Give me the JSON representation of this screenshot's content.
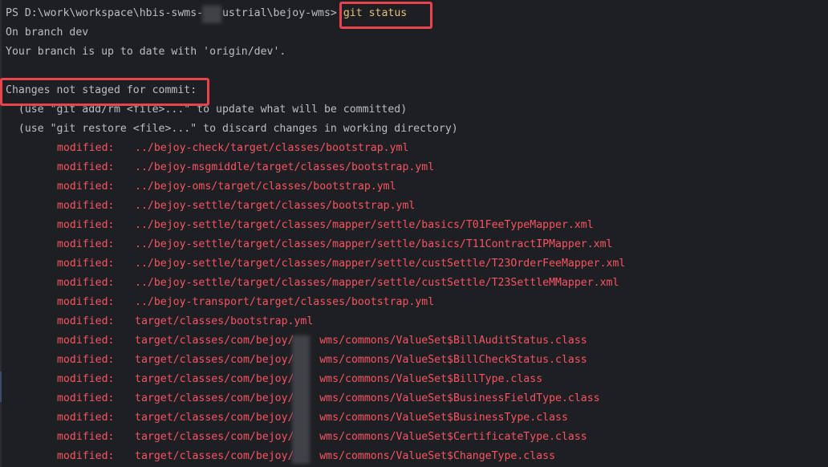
{
  "terminal": {
    "prompt": "PS D:\\work\\workspace\\hbis-swms-   ustrial\\bejoy-wms>",
    "command": "git status",
    "branch_line": "On branch dev",
    "uptodate_line": "Your branch is up to date with 'origin/dev'.",
    "changes_header": "Changes not staged for commit:",
    "hint_add": "  (use \"git add/rm <file>...\" to update what will be committed)",
    "hint_restore": "  (use \"git restore <file>...\" to discard changes in working directory)",
    "modified_label": "modified:",
    "files": [
      "../bejoy-check/target/classes/bootstrap.yml",
      "../bejoy-msgmiddle/target/classes/bootstrap.yml",
      "../bejoy-oms/target/classes/bootstrap.yml",
      "../bejoy-settle/target/classes/bootstrap.yml",
      "../bejoy-settle/target/classes/mapper/settle/basics/T01FeeTypeMapper.xml",
      "../bejoy-settle/target/classes/mapper/settle/basics/T11ContractIPMapper.xml",
      "../bejoy-settle/target/classes/mapper/settle/custSettle/T23OrderFeeMapper.xml",
      "../bejoy-settle/target/classes/mapper/settle/custSettle/T23SettleMMapper.xml",
      "../bejoy-transport/target/classes/bootstrap.yml",
      "target/classes/bootstrap.yml",
      "target/classes/com/bejoy/    wms/commons/ValueSet$BillAuditStatus.class",
      "target/classes/com/bejoy/    wms/commons/ValueSet$BillCheckStatus.class",
      "target/classes/com/bejoy/    wms/commons/ValueSet$BillType.class",
      "target/classes/com/bejoy/    wms/commons/ValueSet$BusinessFieldType.class",
      "target/classes/com/bejoy/    wms/commons/ValueSet$BusinessType.class",
      "target/classes/com/bejoy/    wms/commons/ValueSet$CertificateType.class",
      "target/classes/com/bejoy/    wms/commons/ValueSet$ChangeType.class"
    ]
  },
  "colors": {
    "background": "#1e1f22",
    "text": "#bcbec4",
    "command": "#e5c07b",
    "modified": "#f75464",
    "highlight_box": "#e8434f"
  }
}
